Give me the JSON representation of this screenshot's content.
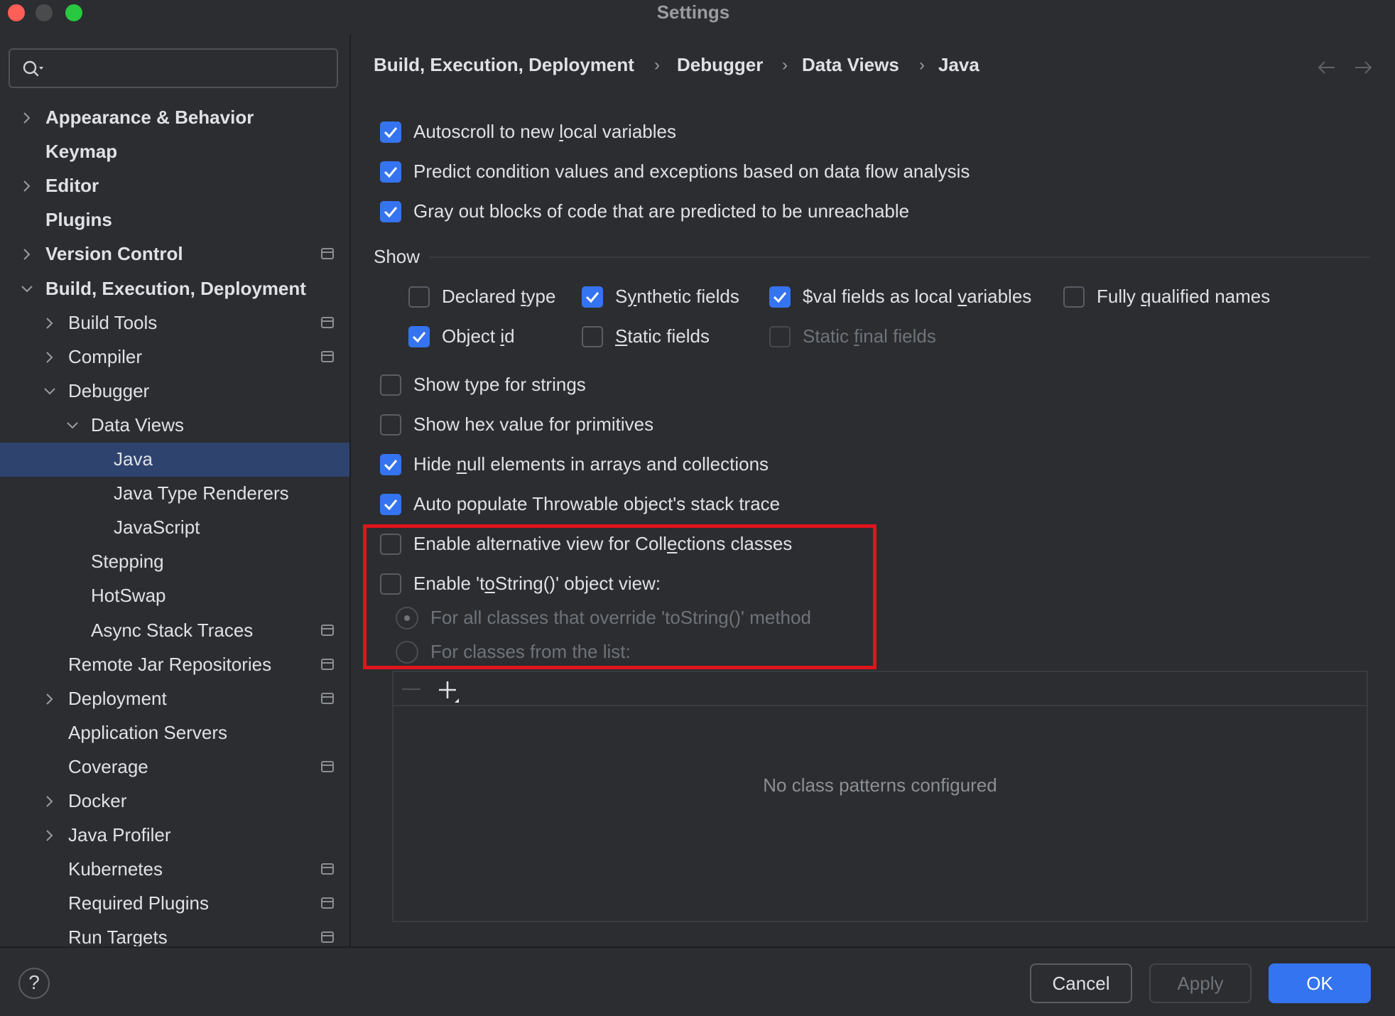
{
  "window": {
    "title": "Settings"
  },
  "sidebar": {
    "search": {
      "placeholder": ""
    },
    "items": [
      {
        "label": "Appearance & Behavior",
        "bold": true,
        "expandable": true,
        "expanded": false,
        "project_icon": false
      },
      {
        "label": "Keymap",
        "bold": true,
        "expandable": false,
        "project_icon": false
      },
      {
        "label": "Editor",
        "bold": true,
        "expandable": true,
        "expanded": false,
        "project_icon": false
      },
      {
        "label": "Plugins",
        "bold": true,
        "expandable": false,
        "project_icon": false
      },
      {
        "label": "Version Control",
        "bold": true,
        "expandable": true,
        "expanded": false,
        "project_icon": true
      },
      {
        "label": "Build, Execution, Deployment",
        "bold": true,
        "expandable": true,
        "expanded": true,
        "project_icon": false
      },
      {
        "label": "Build Tools",
        "bold": false,
        "expandable": true,
        "expanded": false,
        "project_icon": true
      },
      {
        "label": "Compiler",
        "bold": false,
        "expandable": true,
        "expanded": false,
        "project_icon": true
      },
      {
        "label": "Debugger",
        "bold": false,
        "expandable": true,
        "expanded": true,
        "project_icon": false
      },
      {
        "label": "Data Views",
        "bold": false,
        "expandable": true,
        "expanded": true,
        "project_icon": false
      },
      {
        "label": "Java",
        "bold": false,
        "expandable": false,
        "project_icon": false,
        "selected": true
      },
      {
        "label": "Java Type Renderers",
        "bold": false,
        "expandable": false,
        "project_icon": false
      },
      {
        "label": "JavaScript",
        "bold": false,
        "expandable": false,
        "project_icon": false
      },
      {
        "label": "Stepping",
        "bold": false,
        "expandable": false,
        "project_icon": false
      },
      {
        "label": "HotSwap",
        "bold": false,
        "expandable": false,
        "project_icon": false
      },
      {
        "label": "Async Stack Traces",
        "bold": false,
        "expandable": false,
        "project_icon": true
      },
      {
        "label": "Remote Jar Repositories",
        "bold": false,
        "expandable": false,
        "project_icon": true
      },
      {
        "label": "Deployment",
        "bold": false,
        "expandable": true,
        "expanded": false,
        "project_icon": true
      },
      {
        "label": "Application Servers",
        "bold": false,
        "expandable": false,
        "project_icon": false
      },
      {
        "label": "Coverage",
        "bold": false,
        "expandable": false,
        "project_icon": true
      },
      {
        "label": "Docker",
        "bold": false,
        "expandable": true,
        "expanded": false,
        "project_icon": false
      },
      {
        "label": "Java Profiler",
        "bold": false,
        "expandable": true,
        "expanded": false,
        "project_icon": false
      },
      {
        "label": "Kubernetes",
        "bold": false,
        "expandable": false,
        "project_icon": true
      },
      {
        "label": "Required Plugins",
        "bold": false,
        "expandable": false,
        "project_icon": true
      },
      {
        "label": "Run Targets",
        "bold": false,
        "expandable": false,
        "project_icon": true
      }
    ]
  },
  "breadcrumb": [
    "Build, Execution, Deployment",
    "Debugger",
    "Data Views",
    "Java"
  ],
  "options": {
    "autoscroll": {
      "pre": "Autoscroll to new ",
      "u": "l",
      "post": "ocal variables",
      "checked": true
    },
    "predict": {
      "label": "Predict condition values and exceptions based on data flow analysis",
      "checked": true
    },
    "grayout": {
      "label": "Gray out blocks of code that are predicted to be unreachable",
      "checked": true
    }
  },
  "show": {
    "title": "Show",
    "declared_type": {
      "pre": "Declared ",
      "u": "t",
      "post": "ype",
      "checked": false
    },
    "synthetic_fields": {
      "pre": "S",
      "u": "y",
      "post": "nthetic fields",
      "checked": true
    },
    "val_fields": {
      "pre": "$val fields as local ",
      "u": "v",
      "post": "ariables",
      "checked": true
    },
    "fully_qualified": {
      "pre": "Fully ",
      "u": "q",
      "post": "ualified names",
      "checked": false
    },
    "object_id": {
      "pre": "Object ",
      "u": "i",
      "post": "d",
      "checked": true
    },
    "static_fields": {
      "pre": "",
      "u": "S",
      "post": "tatic fields",
      "checked": false
    },
    "static_final": {
      "pre": "Static ",
      "u": "f",
      "post": "inal fields",
      "checked": false,
      "disabled": true
    }
  },
  "more_options": {
    "type_strings": {
      "label": "Show type for strings",
      "checked": false
    },
    "hex_primitives": {
      "label": "Show hex value for primitives",
      "checked": false
    },
    "hide_null": {
      "pre": "Hide ",
      "u": "n",
      "post": "ull elements in arrays and collections",
      "checked": true
    },
    "auto_populate": {
      "label": "Auto populate Throwable object's stack trace",
      "checked": true
    },
    "alt_view": {
      "pre": "Enable alternative view for Coll",
      "u": "e",
      "post": "ctions classes",
      "checked": false
    },
    "tostring_view": {
      "pre": "Enable 't",
      "u": "o",
      "post": "String()' object view:",
      "checked": false
    },
    "radio_all": {
      "label": "For all classes that override 'toString()' method",
      "selected": true,
      "disabled": true
    },
    "radio_list": {
      "label": "For classes from the list:",
      "selected": false,
      "disabled": true
    }
  },
  "class_list": {
    "empty_text": "No class patterns configured"
  },
  "footer": {
    "help": "?",
    "cancel": "Cancel",
    "apply": "Apply",
    "ok": "OK"
  },
  "colors": {
    "accent": "#3574f0",
    "selection": "#2e436e",
    "highlight_box": "#e0141e",
    "background": "#2b2d30"
  }
}
